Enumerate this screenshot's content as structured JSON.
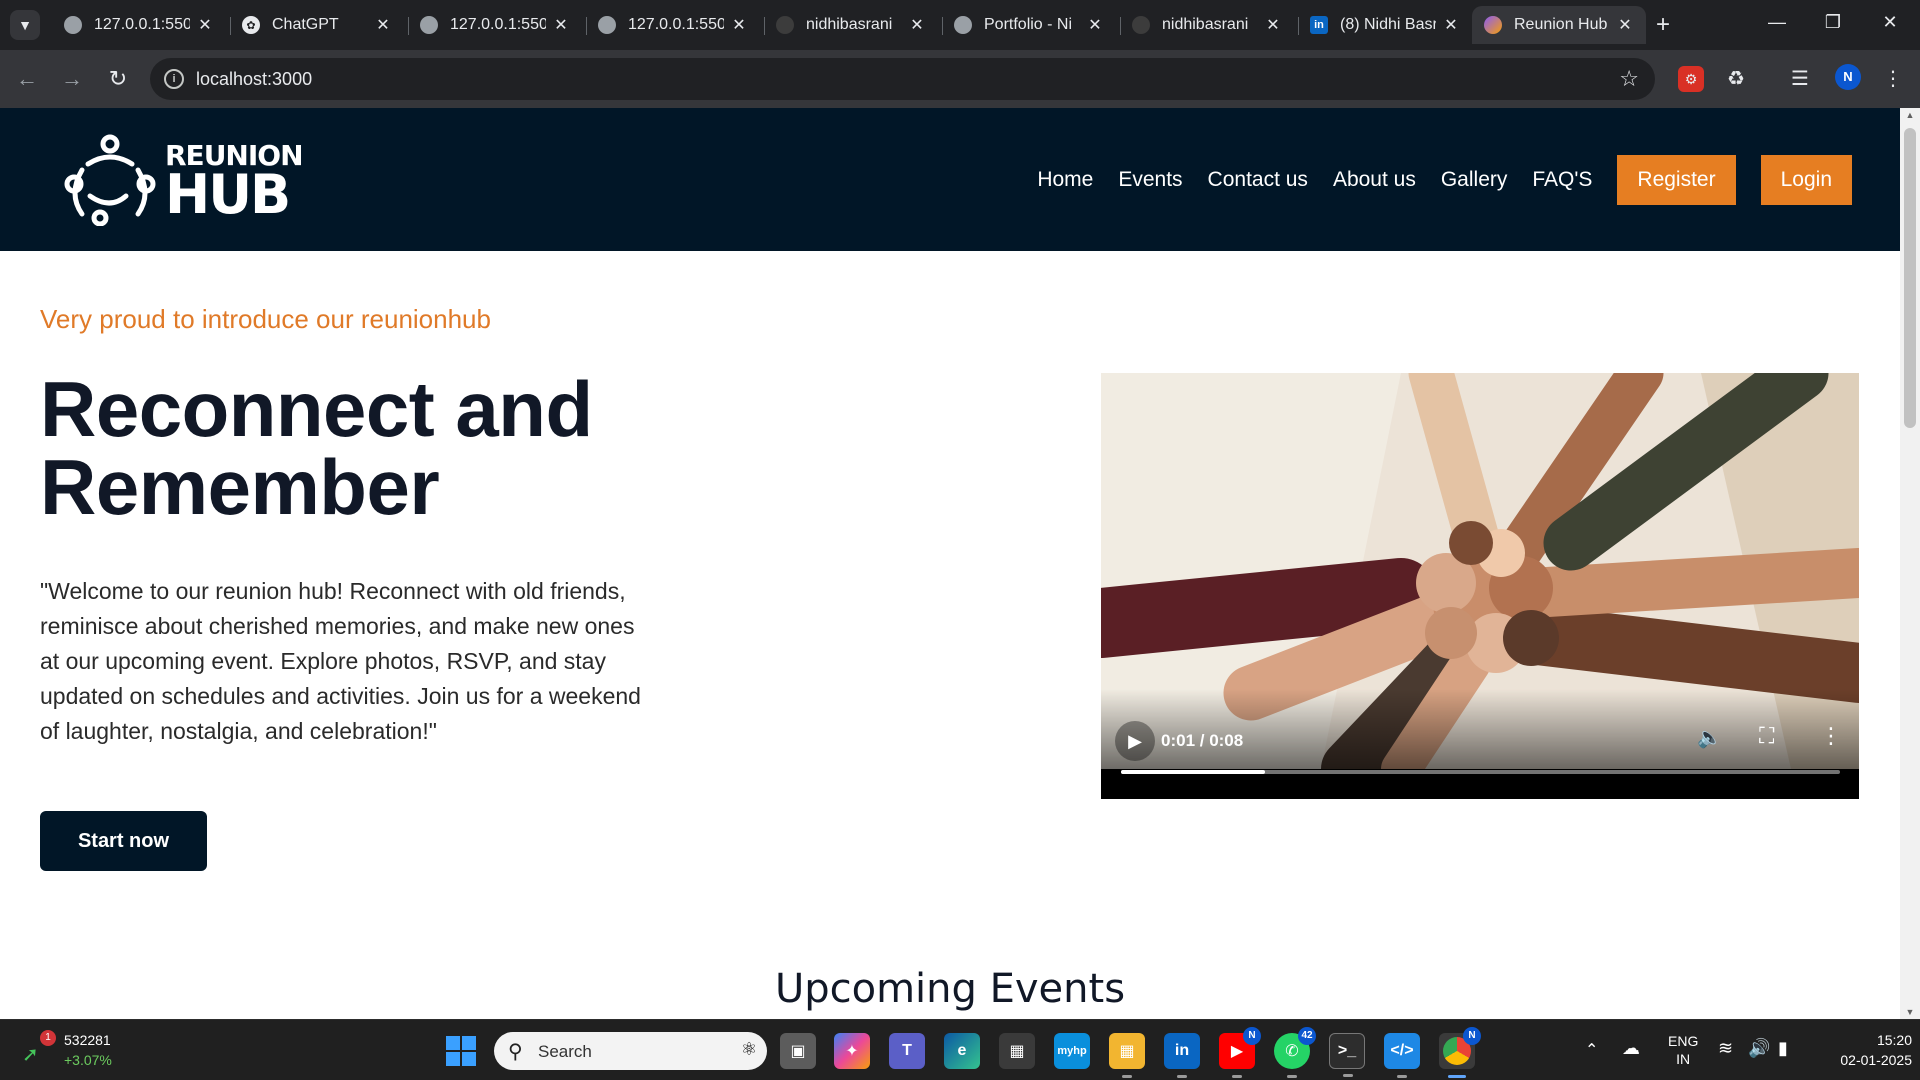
{
  "browser": {
    "tabs": [
      {
        "title": "127.0.0.1:550",
        "icon": "globe-icon"
      },
      {
        "title": "ChatGPT",
        "icon": "chatgpt-icon"
      },
      {
        "title": "127.0.0.1:550",
        "icon": "globe-icon"
      },
      {
        "title": "127.0.0.1:550",
        "icon": "globe-icon"
      },
      {
        "title": "nidhibasrani",
        "icon": "github-icon"
      },
      {
        "title": "Portfolio - Ni",
        "icon": "globe-icon"
      },
      {
        "title": "nidhibasrani",
        "icon": "github-icon"
      },
      {
        "title": "(8) Nidhi Basr",
        "icon": "linkedin-icon"
      },
      {
        "title": "Reunion Hub",
        "icon": "reunionhub-icon"
      }
    ],
    "url": "localhost:3000",
    "profile_initial": "N"
  },
  "site": {
    "logo_line1": "REUNION",
    "logo_line2": "HUB",
    "nav": {
      "home": "Home",
      "events": "Events",
      "contact": "Contact us",
      "about": "About us",
      "gallery": "Gallery",
      "faq": "FAQ'S",
      "register": "Register",
      "login": "Login"
    },
    "hero": {
      "kicker": "Very proud to introduce our reunionhub",
      "title": "Reconnect and Remember",
      "description": "\"Welcome to our reunion hub! Reconnect with old friends, reminisce about cherished memories, and make new ones at our upcoming event. Explore photos, RSVP, and stay updated on schedules and activities. Join us for a weekend of laughter, nostalgia, and celebration!\"",
      "cta": "Start now"
    },
    "video": {
      "time": "0:01 / 0:08",
      "progress_fraction": 0.2
    },
    "section_title": "Upcoming Events"
  },
  "taskbar": {
    "stock_value": "532281",
    "stock_change": "+3.07%",
    "stock_badge": "1",
    "search_placeholder": "Search",
    "whatsapp_badge": "42",
    "lang_line1": "ENG",
    "lang_line2": "IN",
    "time": "15:20",
    "date": "02-01-2025"
  },
  "colors": {
    "header_bg": "#011627",
    "accent": "#e67e22",
    "kicker": "#e07a28"
  }
}
